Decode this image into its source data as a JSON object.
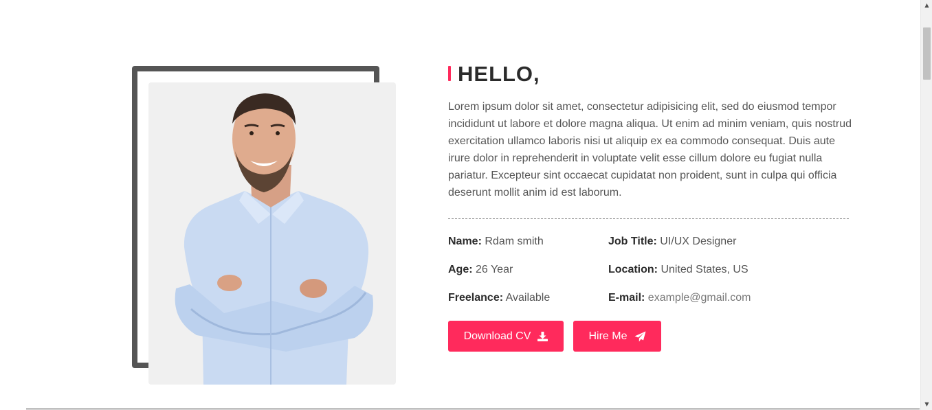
{
  "about": {
    "heading": "HELLO,",
    "bio": "Lorem ipsum dolor sit amet, consectetur adipisicing elit, sed do eiusmod tempor incididunt ut labore et dolore magna aliqua. Ut enim ad minim veniam, quis nostrud exercitation ullamco laboris nisi ut aliquip ex ea commodo consequat. Duis aute irure dolor in reprehenderit in voluptate velit esse cillum dolore eu fugiat nulla pariatur. Excepteur sint occaecat cupidatat non proident, sunt in culpa qui officia deserunt mollit anim id est laborum."
  },
  "info": {
    "name_label": "Name:",
    "name_value": "Rdam smith",
    "job_label": "Job Title:",
    "job_value": "UI/UX Designer",
    "age_label": "Age:",
    "age_value": "26 Year",
    "location_label": "Location:",
    "location_value": "United States, US",
    "freelance_label": "Freelance:",
    "freelance_value": "Available",
    "email_label": "E-mail:",
    "email_value": "example@gmail.com"
  },
  "buttons": {
    "download_label": "Download CV",
    "download_icon": "download-icon",
    "hire_label": "Hire Me",
    "hire_icon": "paper-plane-icon"
  },
  "colors": {
    "accent": "#ff2a5c",
    "frame": "#555555",
    "heading": "#2b2b2b",
    "text": "#555555"
  }
}
